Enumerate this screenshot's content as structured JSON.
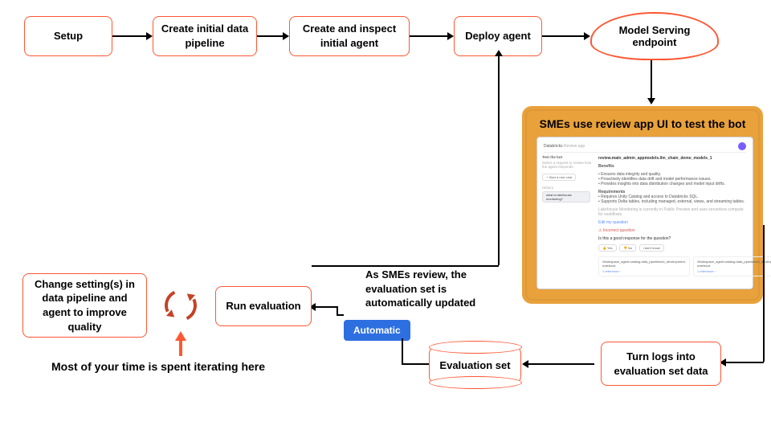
{
  "flow": {
    "setup": "Setup",
    "create_pipeline": "Create initial data pipeline",
    "create_agent": "Create and inspect initial agent",
    "deploy": "Deploy agent",
    "endpoint": "Model Serving endpoint",
    "sme_title": "SMEs use review app UI to test the bot",
    "turn_logs": "Turn logs into evaluation set data",
    "eval_set": "Evaluation set",
    "automatic": "Automatic",
    "sme_note": "As SMEs review, the evaluation set is automatically updated",
    "run_eval": "Run evaluation",
    "change_settings": "Change setting(s) in data pipeline and agent to improve quality",
    "iterate_label": "Most of your time is spent iterating here"
  },
  "mock_ui": {
    "app_name": "Databricks",
    "tab": "Review app",
    "model_path": "review.main_admin_appmodels.llm_chain_demo_models_1",
    "left_heading": "Test the bot",
    "left_sub": "Select a request to review how the agent responds.",
    "history": "History",
    "hist_item": "what is lakehouse monitoring?",
    "section_benefits": "Benefits",
    "b1": "Ensures data integrity and quality.",
    "b2": "Proactively identifies data drift and model performance issues.",
    "b3": "Provides insights into data distribution changes and model input drifts.",
    "section_req": "Requirements",
    "r1": "Requires Unity Catalog and access to Databricks SQL.",
    "r2": "Supports Delta tables, including managed, external, views, and streaming tables.",
    "r_footer": "Lakehouse Monitoring is currently in Public Preview and uses serverless compute for workflows.",
    "edit_link": "Edit my question",
    "warn": "Incorrect question",
    "rate_q": "Is this a good response for the question?",
    "yes": "Yes",
    "no": "No",
    "idk": "I don't know",
    "card_file": "/Workspace_agent.catalog.data_pipelines/d_development-notebook",
    "ref": "reference"
  }
}
